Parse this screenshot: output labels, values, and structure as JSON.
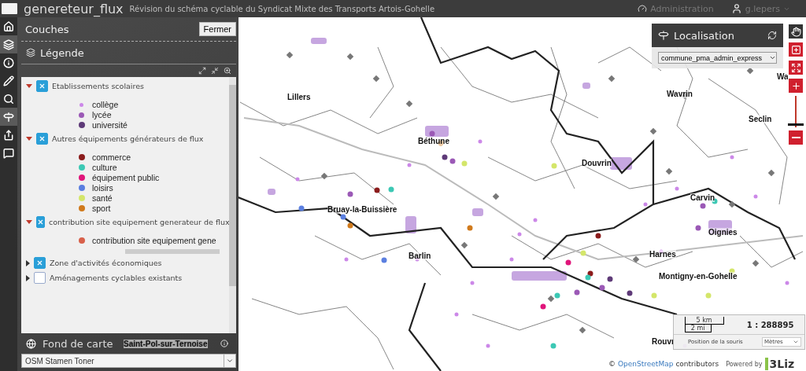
{
  "header": {
    "title": "genereteur_flux",
    "subtitle": "Révision du schéma cyclable du Syndicat Mixte des Transports Artois-Gohelle",
    "admin_label": "Administration",
    "user_label": "g.lepers"
  },
  "sidebar_tools": [
    {
      "kind": "home",
      "selected": false
    },
    {
      "kind": "layers",
      "selected": true
    },
    {
      "kind": "info",
      "selected": false
    },
    {
      "kind": "edit",
      "selected": false
    },
    {
      "kind": "search",
      "selected": false
    },
    {
      "kind": "locate",
      "selected": true
    },
    {
      "kind": "share",
      "selected": false
    },
    {
      "kind": "comment",
      "selected": false
    }
  ],
  "panel": {
    "title": "Couches",
    "close_button": "Fermer",
    "legend_title": "Légende",
    "legend": [
      {
        "label": "Etablissements scolaires",
        "checked": true,
        "expanded": true,
        "items": [
          {
            "label": "collège",
            "color": "#cc88e8"
          },
          {
            "label": "lycée",
            "color": "#9b59b6"
          },
          {
            "label": "université",
            "color": "#5e3a78"
          }
        ]
      },
      {
        "label": "Autres équipements générateurs de flux",
        "checked": true,
        "expanded": true,
        "items": [
          {
            "label": "commerce",
            "color": "#8b1c1c"
          },
          {
            "label": "culture",
            "color": "#3cc8b4"
          },
          {
            "label": "équipement public",
            "color": "#e0157a"
          },
          {
            "label": "loisirs",
            "color": "#5b7fe0"
          },
          {
            "label": "santé",
            "color": "#d4e66a"
          },
          {
            "label": "sport",
            "color": "#d07a1c"
          }
        ]
      },
      {
        "label": "contribution site equipement generateur de flux",
        "checked": true,
        "expanded": true,
        "items": [
          {
            "label": "contribution site equipement gene",
            "color": "#d8604a"
          }
        ]
      },
      {
        "label": "Zone d'activités économiques",
        "checked": true,
        "expanded": false
      },
      {
        "label": "Aménagements cyclables existants",
        "checked": false,
        "expanded": false
      }
    ],
    "basemap": {
      "title": "Fond de carte",
      "value": "OSM Stamen Toner",
      "map_label": "Saint-Pol-sur-Ternoise"
    }
  },
  "map": {
    "places": [
      "Lillers",
      "Béthune",
      "Douvrin",
      "Wavrin",
      "Seclin",
      "Wa",
      "Carvin",
      "Oignies",
      "Bruay-la-Buissière",
      "Barlin",
      "Harnes",
      "Montigny-en-Gohelle",
      "Rouvr"
    ],
    "localisation": {
      "title": "Localisation",
      "value": "commune_pma_admin_express"
    },
    "tools": [
      {
        "kind": "pan",
        "selected": true
      },
      {
        "kind": "zoom_box",
        "selected": false
      },
      {
        "kind": "extent",
        "selected": false
      },
      {
        "kind": "zoom_in",
        "selected": false
      },
      {
        "kind": "slider",
        "level": 0.05
      },
      {
        "kind": "zoom_out",
        "selected": false
      }
    ],
    "scale": {
      "km": "5 km",
      "mi": "2 mi",
      "ratio": "1 : 288895",
      "mouse_position": "Position de la souris",
      "unit": "Mètres"
    },
    "attribution": {
      "copyright": "©",
      "link": "OpenStreetMap",
      "suffix": "contributors",
      "powered": "Powered by",
      "logo": "3Liz"
    }
  }
}
